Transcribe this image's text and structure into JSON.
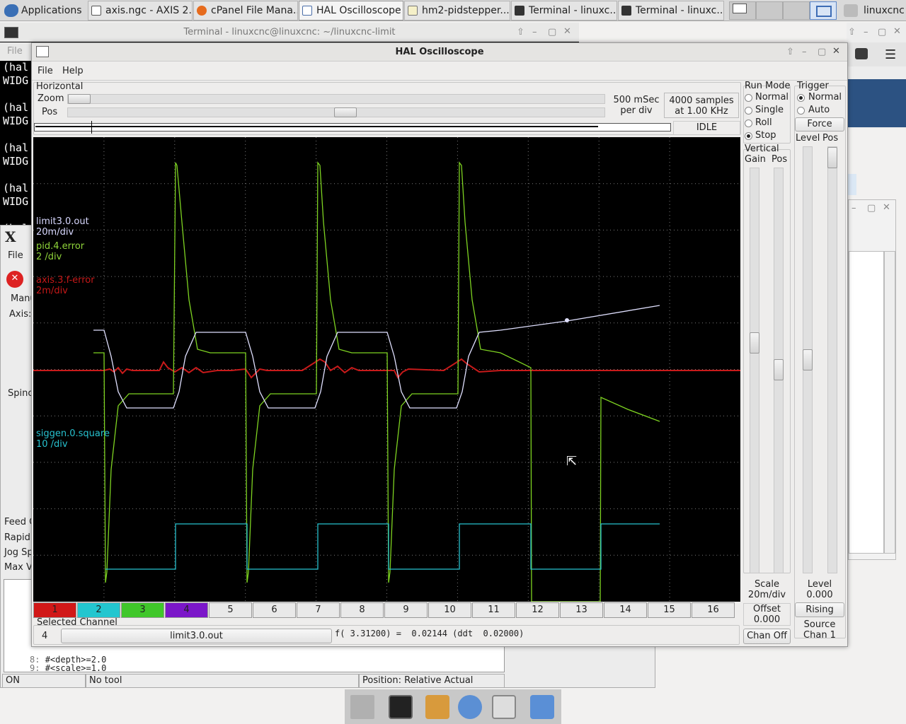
{
  "taskbar": {
    "apps_label": "Applications",
    "tabs": [
      {
        "label": "axis.ngc - AXIS 2...",
        "icon": "x-icon"
      },
      {
        "label": "cPanel File Mana...",
        "icon": "firefox-icon"
      },
      {
        "label": "HAL Oscilloscope",
        "icon": "window-icon"
      },
      {
        "label": "hm2-pidstepper....",
        "icon": "editor-icon"
      },
      {
        "label": "Terminal - linuxc...",
        "icon": "terminal-icon"
      },
      {
        "label": "Terminal - linuxc...",
        "icon": "terminal-icon"
      }
    ],
    "user_label": "linuxcnc"
  },
  "terminal": {
    "title": "Terminal - linuxcnc@linuxcnc: ~/linuxcnc-limit",
    "menu_file": "File",
    "lines": [
      "(hal",
      "WIDG",
      "(hal",
      "WIDG",
      "(hal",
      "WIDG",
      "(hal",
      "WIDG",
      "(hal"
    ]
  },
  "axis": {
    "menu_file": "File",
    "tab_manual": "Manu",
    "axis_label": "Axis:",
    "spindle_label": "Spinc",
    "feed_label": "Feed C",
    "rapid_label": "Rapid",
    "jog_label": "Jog Sp",
    "maxv_label": "Max Ve",
    "code_lines": [
      {
        "num": "8:",
        "text": "#<depth>=2.0"
      },
      {
        "num": "9:",
        "text": "#<scale>=1.0"
      }
    ],
    "status_on": "ON",
    "status_tool": "No tool",
    "status_position": "Position: Relative Actual"
  },
  "halscope": {
    "title": "HAL Oscilloscope",
    "menu": {
      "file": "File",
      "help": "Help"
    },
    "horizontal": {
      "group_label": "Horizontal",
      "zoom_label": "Zoom",
      "pos_label": "Pos",
      "rate_line1": "500 mSec",
      "rate_line2": "per div",
      "samples_line1": "4000 samples",
      "samples_line2": "at 1.00 KHz",
      "state": "IDLE",
      "zoom_value": 0.0,
      "pos_value": 0.5
    },
    "run_mode": {
      "label": "Run Mode",
      "options": [
        "Normal",
        "Single",
        "Roll",
        "Stop"
      ],
      "selected": "Stop"
    },
    "trigger": {
      "label": "Trigger",
      "options": [
        "Normal",
        "Auto"
      ],
      "selected": "Normal",
      "force_label": "Force",
      "level_label": "Level",
      "pos_label": "Pos",
      "level_text": "Level",
      "level_value": "0.000",
      "edge_button": "Rising",
      "source_line1": "Source",
      "source_line2": "Chan  1"
    },
    "vertical": {
      "label": "Vertical",
      "gain_label": "Gain",
      "pos_label": "Pos",
      "scale_line1": "Scale",
      "scale_line2": "20m/div",
      "offset_line1": "Offset",
      "offset_line2": "0.000",
      "chan_off": "Chan Off"
    },
    "channel_labels": [
      {
        "name": "limit3.0.out",
        "scale": "20m/div",
        "color": "#d8d8ff"
      },
      {
        "name": "pid.4.error",
        "scale": "2 /div",
        "color": "#8fd43a"
      },
      {
        "name": "axis.3.f-error",
        "scale": "2m/div",
        "color": "#c51818"
      },
      {
        "name": "siggen.0.square",
        "scale": "10 /div",
        "color": "#27c2cf"
      }
    ],
    "channels": [
      {
        "num": "1",
        "color": "#d11818"
      },
      {
        "num": "2",
        "color": "#23c6cf"
      },
      {
        "num": "3",
        "color": "#40c72a"
      },
      {
        "num": "4",
        "color": "#7b16c9"
      },
      {
        "num": "5",
        "color": ""
      },
      {
        "num": "6",
        "color": ""
      },
      {
        "num": "7",
        "color": ""
      },
      {
        "num": "8",
        "color": ""
      },
      {
        "num": "9",
        "color": ""
      },
      {
        "num": "10",
        "color": ""
      },
      {
        "num": "11",
        "color": ""
      },
      {
        "num": "12",
        "color": ""
      },
      {
        "num": "13",
        "color": ""
      },
      {
        "num": "14",
        "color": ""
      },
      {
        "num": "15",
        "color": ""
      },
      {
        "num": "16",
        "color": ""
      }
    ],
    "selected_channel": {
      "label": "Selected Channel",
      "number": "4",
      "signal": "limit3.0.out",
      "readout": "f( 3.31200) =  0.02144 (ddt  0.02000)"
    }
  }
}
